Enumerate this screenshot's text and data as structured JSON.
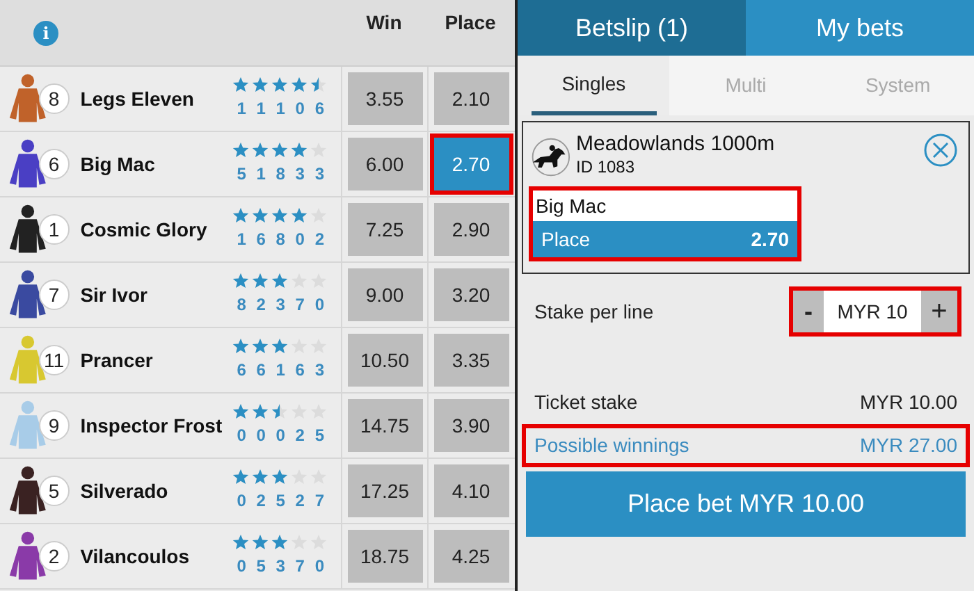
{
  "race_card": {
    "info_icon": "i",
    "columns": [
      "Win",
      "Place"
    ],
    "runners": [
      {
        "number": "8",
        "name": "Legs Eleven",
        "color": "#c0622a",
        "stars": 4.5,
        "form": "1 1 1 0 6",
        "win": "3.55",
        "place": "2.10",
        "win_selected": false,
        "place_selected": false,
        "place_annotated": false
      },
      {
        "number": "6",
        "name": "Big Mac",
        "color": "#4a3fc4",
        "stars": 4,
        "form": "5 1 8 3 3",
        "win": "6.00",
        "place": "2.70",
        "win_selected": false,
        "place_selected": true,
        "place_annotated": true
      },
      {
        "number": "1",
        "name": "Cosmic Glory",
        "color": "#222222",
        "stars": 4,
        "form": "1 6 8 0 2",
        "win": "7.25",
        "place": "2.90",
        "win_selected": false,
        "place_selected": false,
        "place_annotated": false
      },
      {
        "number": "7",
        "name": "Sir Ivor",
        "color": "#3a4aa0",
        "stars": 3,
        "form": "8 2 3 7 0",
        "win": "9.00",
        "place": "3.20",
        "win_selected": false,
        "place_selected": false,
        "place_annotated": false
      },
      {
        "number": "11",
        "name": "Prancer",
        "color": "#d8c830",
        "stars": 3,
        "form": "6 6 1 6 3",
        "win": "10.50",
        "place": "3.35",
        "win_selected": false,
        "place_selected": false,
        "place_annotated": false
      },
      {
        "number": "9",
        "name": "Inspector Frost",
        "color": "#a8cce8",
        "stars": 2.5,
        "form": "0 0 0 2 5",
        "win": "14.75",
        "place": "3.90",
        "win_selected": false,
        "place_selected": false,
        "place_annotated": false
      },
      {
        "number": "5",
        "name": "Silverado",
        "color": "#3a2222",
        "stars": 3,
        "form": "0 2 5 2 7",
        "win": "17.25",
        "place": "4.10",
        "win_selected": false,
        "place_selected": false,
        "place_annotated": false
      },
      {
        "number": "2",
        "name": "Vilancoulos",
        "color": "#8a3aa8",
        "stars": 3,
        "form": "0 5 3 7 0",
        "win": "18.75",
        "place": "4.25",
        "win_selected": false,
        "place_selected": false,
        "place_annotated": false
      }
    ]
  },
  "betslip": {
    "tabs": [
      {
        "label": "Betslip (1)",
        "selected": true
      },
      {
        "label": "My bets",
        "selected": false
      }
    ],
    "subtabs": [
      {
        "label": "Singles",
        "selected": true
      },
      {
        "label": "Multi",
        "selected": false
      },
      {
        "label": "System",
        "selected": false
      }
    ],
    "bet": {
      "event": "Meadowlands 1000m",
      "id": "ID 1083",
      "selection": "Big Mac",
      "market": "Place",
      "odds": "2.70",
      "annotated": true
    },
    "stake": {
      "label": "Stake per line",
      "minus": "-",
      "value": "MYR 10",
      "plus": "+",
      "annotated": true
    },
    "ticket_stake": {
      "label": "Ticket stake",
      "value": "MYR 10.00"
    },
    "possible_winnings": {
      "label": "Possible winnings",
      "value": "MYR 27.00",
      "annotated": true
    },
    "place_bet_button": "Place bet MYR 10.00"
  }
}
